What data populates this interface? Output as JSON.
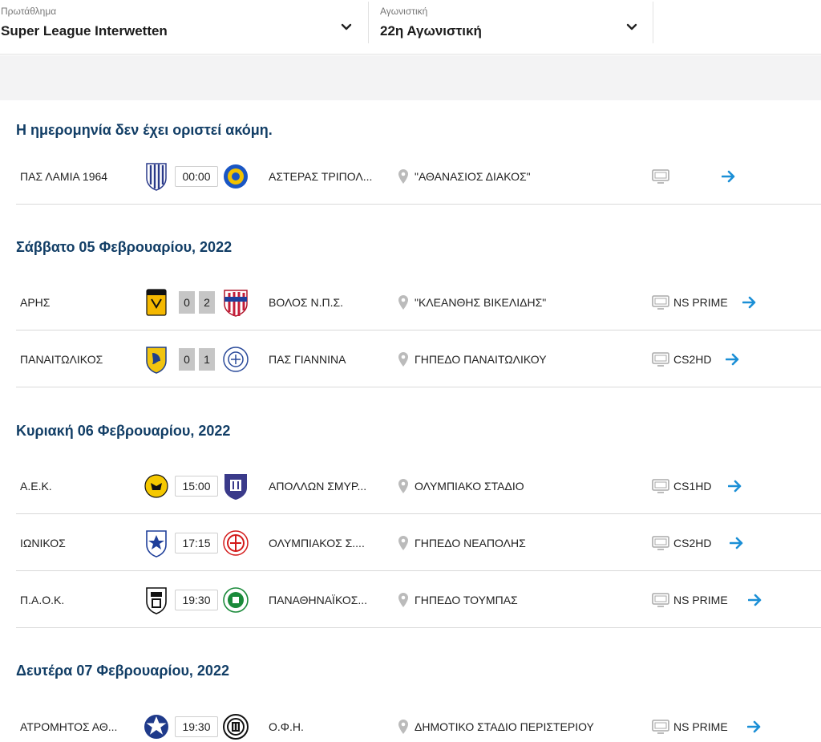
{
  "filters": {
    "league": {
      "label": "Πρωτάθλημα",
      "value": "Super League Interwetten"
    },
    "round": {
      "label": "Αγωνιστική",
      "value": "22η Αγωνιστική"
    }
  },
  "days": [
    {
      "title": "Η ημερομηνία δεν έχει οριστεί ακόμη.",
      "matches": [
        {
          "home": "ΠΑΣ ΛΑΜΙΑ 1964",
          "time": "00:00",
          "away": "ΑΣΤΕΡΑΣ ΤΡΙΠΟΛ...",
          "venue": "\"ΑΘΑΝΑΣΙΟΣ ΔΙΑΚΟΣ\"",
          "channel": ""
        }
      ]
    },
    {
      "title": "Σάββατο 05 Φεβρουαρίου, 2022",
      "matches": [
        {
          "home": "ΑΡΗΣ",
          "score_home": "0",
          "score_away": "2",
          "away": "ΒΟΛΟΣ Ν.Π.Σ.",
          "venue": "\"ΚΛΕΑΝΘΗΣ ΒΙΚΕΛΙΔΗΣ\"",
          "channel": "NS PRIME"
        },
        {
          "home": "ΠΑΝΑΙΤΩΛΙΚΟΣ",
          "score_home": "0",
          "score_away": "1",
          "away": "ΠΑΣ ΓΙΑΝΝΙΝΑ",
          "venue": "ΓΗΠΕΔΟ ΠΑΝΑΙΤΩΛΙΚΟΥ",
          "channel": "CS2HD"
        }
      ]
    },
    {
      "title": "Κυριακή 06 Φεβρουαρίου, 2022",
      "matches": [
        {
          "home": "Α.Ε.Κ.",
          "time": "15:00",
          "away": "ΑΠΟΛΛΩΝ ΣΜΥΡ...",
          "venue": "ΟΛΥΜΠΙΑΚΟ ΣΤΑΔΙΟ",
          "channel": "CS1HD"
        },
        {
          "home": "ΙΩΝΙΚΟΣ",
          "time": "17:15",
          "away": "ΟΛΥΜΠΙΑΚΟΣ Σ....",
          "venue": "ΓΗΠΕΔΟ ΝΕΑΠΟΛΗΣ",
          "channel": "CS2HD"
        },
        {
          "home": "Π.Α.Ο.Κ.",
          "time": "19:30",
          "away": "ΠΑΝΑΘΗΝΑΪΚΟΣ...",
          "venue": "ΓΗΠΕΔΟ ΤΟΥΜΠΑΣ",
          "channel": "NS PRIME"
        }
      ]
    },
    {
      "title": "Δευτέρα 07 Φεβρουαρίου, 2022",
      "matches": [
        {
          "home": "ΑΤΡΟΜΗΤΟΣ ΑΘ...",
          "time": "19:30",
          "away": "Ο.Φ.Η.",
          "venue": "ΔΗΜΟΤΙΚΟ ΣΤΑΔΙΟ ΠΕΡΙΣΤΕΡΙΟΥ",
          "channel": "NS PRIME"
        }
      ]
    }
  ],
  "colors": {
    "heading": "#123e66",
    "arrow": "#1b8fd6",
    "score_bg": "#c6c6c6",
    "band": "#f3f3f4"
  },
  "icons": {
    "dropdown": "chevron-down-icon",
    "venue": "map-pin-icon",
    "tv": "tv-icon",
    "details": "arrow-right-icon",
    "crest": "team-crest-icon"
  }
}
